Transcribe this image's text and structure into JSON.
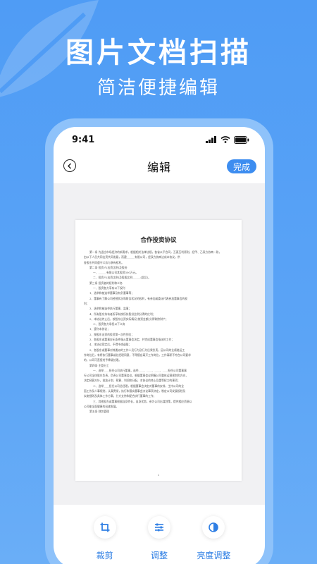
{
  "promo": {
    "headline": "图片文档扫描",
    "subline": "简洁便捷编辑"
  },
  "statusbar": {
    "time": "9:41",
    "icons": [
      "signal-icon",
      "wifi-icon",
      "battery-icon"
    ]
  },
  "navbar": {
    "back_icon": "chevron-left-icon",
    "title": "编辑",
    "done_label": "完成"
  },
  "document": {
    "title": "合作投资协议",
    "page_number": "1",
    "lines": [
      {
        "style": "indent",
        "text": "第一条    为适应市场经济的新需求，根据相关法律法规，各省公平合同，互惠互利原则，经甲、乙双方协商一致，"
      },
      {
        "style": "",
        "text": "由以下人员共同出资共同发展，而建______有限公司，经双方协商达成本协议，供"
      },
      {
        "style": "",
        "text": "各股东共同遵守义务与享有权利。"
      },
      {
        "style": "indent",
        "text": "第二条    投资人(出资比例)及股份"
      },
      {
        "style": "sub",
        "text": "一、______有限公司其股资300万元。"
      },
      {
        "style": "sub",
        "text": "二、投资人(出资比例)及股股比例______(此后)。"
      },
      {
        "style": "indent",
        "text": "第三条    投资者的权利和义务"
      },
      {
        "style": "sub",
        "text": "一、股资各方享有以下权利"
      },
      {
        "style": "indent",
        "text": "1、选举和被选举董事及有负董事等；"
      },
      {
        "style": "indent",
        "text": "2、董事有了解公司经营状况和财务状况的权利，有参加或委派代表参加董事会的权"
      },
      {
        "style": "",
        "text": "利；"
      },
      {
        "style": "indent",
        "text": "3、选举和被选举执行董事、监事；"
      },
      {
        "style": "indent",
        "text": "4、所有股东持有者所享有按所持股份比例分得的红利；"
      },
      {
        "style": "indent",
        "text": "5、本协议终止后，按股东出资实际情况(按资金额)分得剩余财产；"
      },
      {
        "style": "sub",
        "text": "二、股资各方承担以下义务"
      },
      {
        "style": "indent",
        "text": "1、遵守本协议；"
      },
      {
        "style": "indent",
        "text": "2、按股东出资的投资第一次性到位；"
      },
      {
        "style": "indent",
        "text": "3、各股东或董事应无条件服从董事会决定，并完成董事会指派的工作；"
      },
      {
        "style": "indent",
        "text": "4、本协议签定后，不得中途退股；"
      },
      {
        "style": "indent",
        "text": "5、各股东或董事对其委派的工作人员行为及行为后果负责，因公司的业绩能运工"
      },
      {
        "style": "",
        "text": "作岗位后，有将执行董事或总经理同意，不得擅自离开工作岗位，工作离职不符合公司要求"
      },
      {
        "style": "",
        "text": "的，公司可直接给予降级处理。"
      },
      {
        "style": "indent",
        "text": "第四条    主管分工"
      },
      {
        "style": "sub",
        "text": "一、选举____担任公司执行董事，选举____、____、____、____担任公司董事事"
      },
      {
        "style": "",
        "text": "行公司全体股东负责，负责公司董事会议，根据董事会议把握公司整体运营规划和方向，"
      },
      {
        "style": "",
        "text": "决定经营方针，批准计划、预算、利润和分配，本协议的终止及重等权力的事项；"
      },
      {
        "style": "sub",
        "text": "二、选举____担任公司总经理，根据董事会决定对董事的安排，主持公司的全"
      },
      {
        "style": "",
        "text": "面工作及人事规划，认真贯彻，执行和落实董事会决议事项决定，制定公司发展规划及"
      },
      {
        "style": "",
        "text": "实施细则及具体工作方案，分方支持和配合执行董事的工作；"
      },
      {
        "style": "sub",
        "text": "三、其他股东或董事根据自身特长，自身优势，参为公司出谋划策，提供相应资源以"
      },
      {
        "style": "",
        "text": "公司能全面健康的迅速发展。"
      },
      {
        "style": "indent",
        "text": "第五条    财务管理"
      }
    ]
  },
  "toolbar": {
    "tools": [
      {
        "icon": "crop-icon",
        "label": "裁剪"
      },
      {
        "icon": "sliders-icon",
        "label": "调整"
      },
      {
        "icon": "brightness-icon",
        "label": "亮度调整"
      }
    ]
  },
  "colors": {
    "background": "#5ba4f6",
    "accent": "#3d8df0",
    "tool_label": "#2f7fe4"
  }
}
